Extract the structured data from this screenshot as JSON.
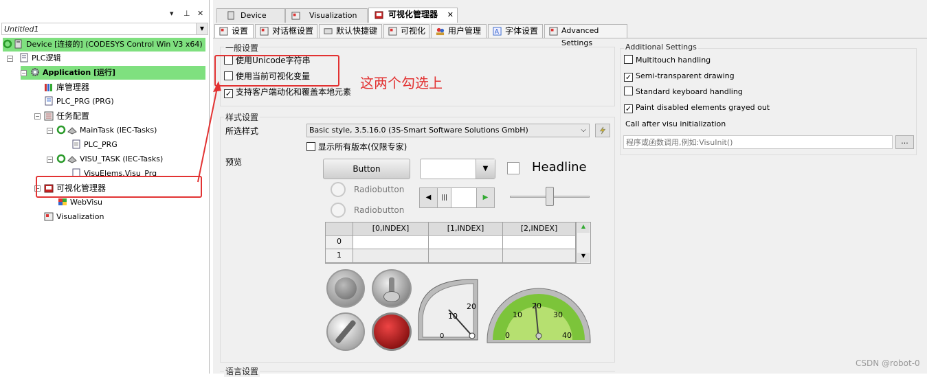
{
  "left_pane": {
    "project_name": "Untitled1",
    "header_buttons": {
      "dropdown": "▾",
      "pin": "ꟷ",
      "close": "✕"
    },
    "tree": [
      {
        "label": "Device [连接的] (CODESYS Control Win V3 x64)",
        "icon": "device-icon"
      },
      {
        "label": "PLC逻辑",
        "icon": "plc-logic-icon"
      },
      {
        "label": "Application [运行]",
        "icon": "application-gear-icon"
      },
      {
        "label": "库管理器",
        "icon": "library-manager-icon"
      },
      {
        "label": "PLC_PRG (PRG)",
        "icon": "program-icon"
      },
      {
        "label": "任务配置",
        "icon": "task-config-icon"
      },
      {
        "label": "MainTask (IEC-Tasks)",
        "icon": "task-icon"
      },
      {
        "label": "PLC_PRG",
        "icon": "program-call-icon"
      },
      {
        "label": "VISU_TASK (IEC-Tasks)",
        "icon": "task-icon"
      },
      {
        "label": "VisuElems.Visu_Prg",
        "icon": "program-call-icon"
      },
      {
        "label": "可视化管理器",
        "icon": "visu-manager-icon"
      },
      {
        "label": "WebVisu",
        "icon": "webvisu-icon"
      },
      {
        "label": "Visualization",
        "icon": "visualization-icon"
      }
    ]
  },
  "doc_tabs": [
    {
      "label": "Device"
    },
    {
      "label": "Visualization"
    },
    {
      "label": "可视化管理器",
      "close": "✕"
    }
  ],
  "sub_tabs": [
    {
      "label": "设置"
    },
    {
      "label": "对话框设置"
    },
    {
      "label": "默认快捷键"
    },
    {
      "label": "可视化"
    },
    {
      "label": "用户管理"
    },
    {
      "label": "字体设置"
    },
    {
      "label": "Advanced Settings"
    }
  ],
  "general": {
    "title": "一般设置",
    "options": [
      {
        "label": "使用Unicode字符串",
        "checked": false
      },
      {
        "label": "使用当前可视化变量",
        "checked": false
      },
      {
        "label": "支持客户端动化和覆盖本地元素",
        "checked": true
      }
    ],
    "annotation": "这两个勾选上"
  },
  "style": {
    "title": "样式设置",
    "selected_label": "所选样式",
    "selected_value": "Basic style, 3.5.16.0 (3S-Smart Software Solutions GmbH)",
    "show_all_label": "显示所有版本(仅限专家)",
    "preview_label": "预览",
    "preview": {
      "button": "Button",
      "headline": "Headline",
      "radio1": "Radiobutton",
      "radio2": "Radiobutton",
      "table_headers": [
        "[0,INDEX]",
        "[1,INDEX]",
        "[2,INDEX]"
      ],
      "table_rows": [
        "0",
        "1"
      ],
      "gauge1_ticks": [
        "0",
        "10",
        "20"
      ],
      "gauge2_ticks": [
        "0",
        "10",
        "20",
        "30",
        "40"
      ]
    }
  },
  "language_title": "语言设置",
  "additional": {
    "title": "Additional Settings",
    "options": [
      {
        "label": "Multitouch handling",
        "checked": false
      },
      {
        "label": "Semi-transparent drawing",
        "checked": true
      },
      {
        "label": "Standard keyboard handling",
        "checked": false
      },
      {
        "label": "Paint disabled elements grayed out",
        "checked": true
      }
    ],
    "call_after_label": "Call after visu initialization",
    "call_after_placeholder": "程序或函数调用,例如:VisuInit() ",
    "browse_label": "..."
  },
  "watermark": "CSDN @robot-0",
  "colors": {
    "highlight_green": "#7fe07f",
    "annotation_red": "#e23232"
  }
}
